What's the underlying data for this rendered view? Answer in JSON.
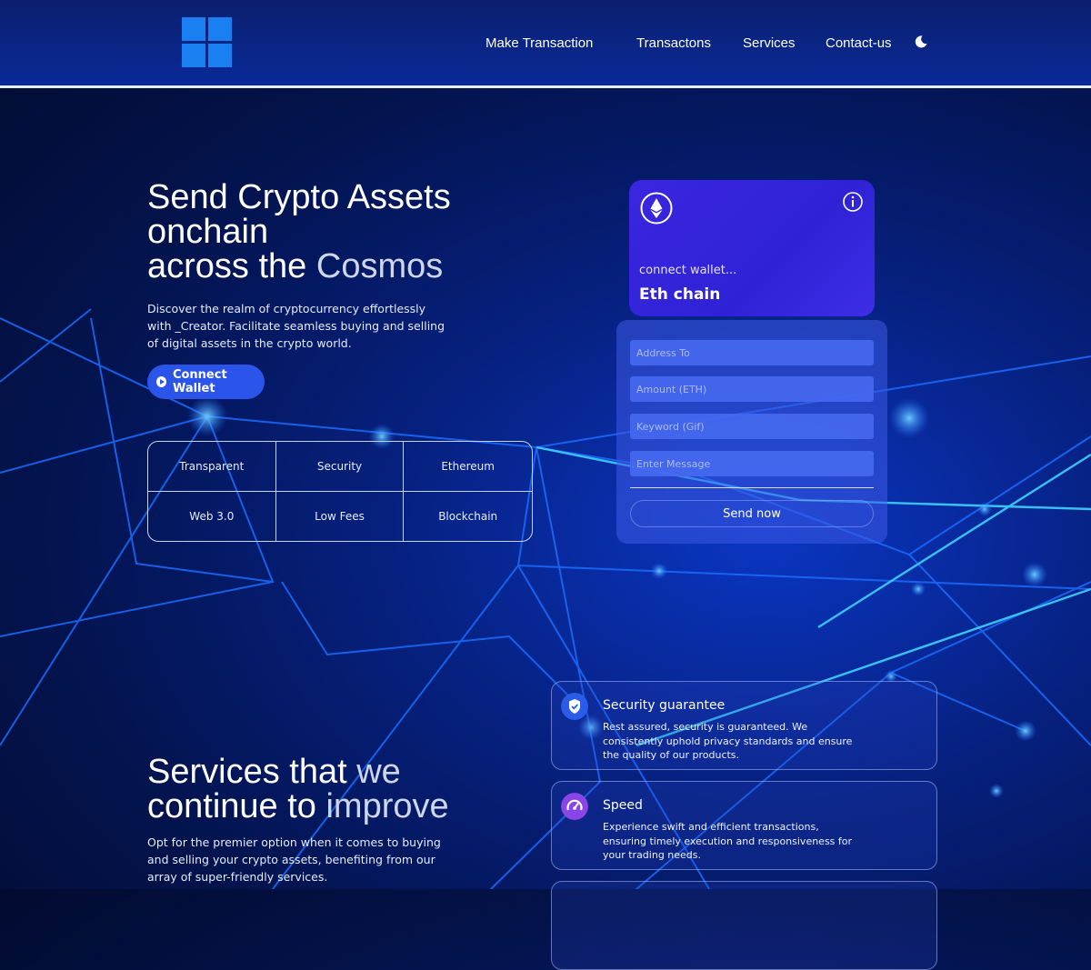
{
  "header": {
    "nav": [
      "Make Transaction",
      "Transactons",
      "Services",
      "Contact-us"
    ]
  },
  "hero": {
    "title_line1": "Send Crypto Assets",
    "title_line2": "onchain",
    "title_line3_a": "across the ",
    "title_line3_b": "Cosmos",
    "description": "Discover the realm of cryptocurrency effortlessly with _Creator. Facilitate seamless buying and selling of digital assets in the crypto world.",
    "connect_button": "Connect Wallet",
    "features": [
      "Transparent",
      "Security",
      "Ethereum",
      "Web 3.0",
      "Low Fees",
      "Blockchain"
    ]
  },
  "eth_card": {
    "status": "connect wallet...",
    "chain": "Eth chain"
  },
  "form": {
    "address_placeholder": "Address To",
    "amount_placeholder": "Amount (ETH)",
    "keyword_placeholder": "Keyword (Gif)",
    "message_placeholder": "Enter Message",
    "send_button": "Send now"
  },
  "services": {
    "title_line1_a": "Services that ",
    "title_line1_b": "we",
    "title_line2_a": "continue to ",
    "title_line2_b": "improve",
    "description": "Opt for the premier option when it comes to buying and selling your crypto assets, benefiting from our array of super-friendly services.",
    "items": [
      {
        "title": "Security guarantee",
        "text": "Rest assured, security is guaranteed. We consistently uphold privacy standards and ensure the quality of our products.",
        "icon": "shield-check-icon",
        "color": "#2b5ce8"
      },
      {
        "title": "Speed",
        "text": "Experience swift and efficient transactions, ensuring timely execution and responsiveness for your trading needs.",
        "icon": "speedometer-icon",
        "color": "#8a45e6"
      }
    ]
  },
  "colors": {
    "accent": "#2a54ea",
    "card": "#3326de"
  }
}
